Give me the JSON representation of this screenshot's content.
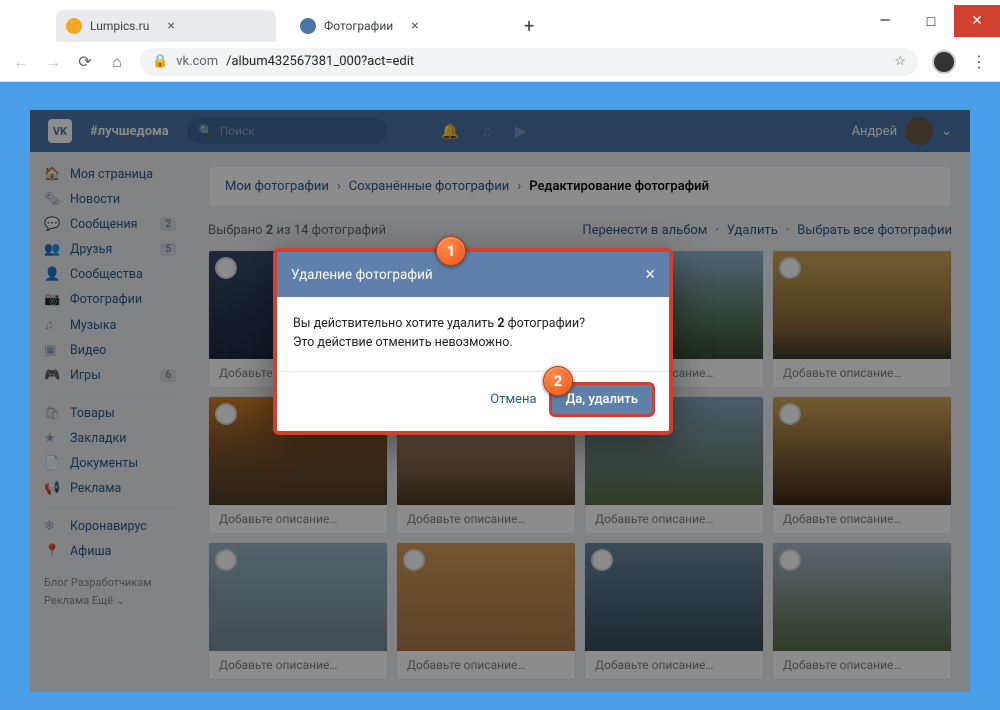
{
  "window": {
    "title": "Фотографии"
  },
  "tabs": [
    {
      "label": "Lumpics.ru",
      "favicon": "#f5a623"
    },
    {
      "label": "Фотографии",
      "favicon": "#4a76a8",
      "active": true
    }
  ],
  "address": {
    "url_host": "vk.com",
    "url_path": "/album432567381_000?act=edit"
  },
  "vk_header": {
    "logo": "VK",
    "tag": "#лучшедома",
    "search_placeholder": "Поиск",
    "user_name": "Андрей"
  },
  "sidebar": {
    "items": [
      {
        "icon": "🏠",
        "label": "Моя страница"
      },
      {
        "icon": "🗞",
        "label": "Новости"
      },
      {
        "icon": "💬",
        "label": "Сообщения",
        "badge": "2"
      },
      {
        "icon": "👥",
        "label": "Друзья",
        "badge": "5"
      },
      {
        "icon": "👤",
        "label": "Сообщества"
      },
      {
        "icon": "📷",
        "label": "Фотографии"
      },
      {
        "icon": "♫",
        "label": "Музыка"
      },
      {
        "icon": "▣",
        "label": "Видео"
      },
      {
        "icon": "🎮",
        "label": "Игры",
        "badge": "6"
      }
    ],
    "items2": [
      {
        "icon": "🛍",
        "label": "Товары"
      },
      {
        "icon": "★",
        "label": "Закладки"
      },
      {
        "icon": "📄",
        "label": "Документы"
      },
      {
        "icon": "📢",
        "label": "Реклама"
      }
    ],
    "items3": [
      {
        "icon": "❄",
        "label": "Коронавирус"
      },
      {
        "icon": "📍",
        "label": "Афиша"
      }
    ],
    "footer": "Блог   Разработчикам\nРеклама   Ещё ⌄"
  },
  "breadcrumbs": {
    "a": "Мои фотографии",
    "b": "Сохранённые фотографии",
    "c": "Редактирование фотографий",
    "sep": "›"
  },
  "toolbar": {
    "selected_prefix": "Выбрано ",
    "selected_count": "2",
    "selected_suffix": " из 14 фотографий",
    "move": "Перенести в альбом",
    "del": "Удалить",
    "select_all": "Выбрать все фотографии",
    "dot": "·"
  },
  "caption_placeholder": "Добавьте описание…",
  "modal": {
    "title": "Удаление фотографий",
    "body_pre": "Вы действительно хотите удалить ",
    "body_count": "2",
    "body_post": " фотографии?",
    "body_line2": "Это действие отменить невозможно.",
    "cancel": "Отмена",
    "confirm": "Да, удалить"
  },
  "annotations": {
    "a1": "1",
    "a2": "2"
  }
}
